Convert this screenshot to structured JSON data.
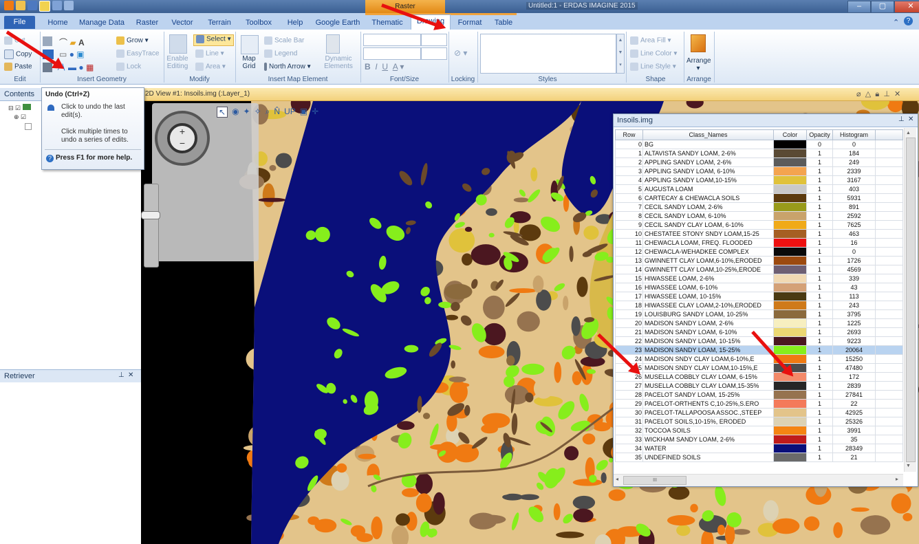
{
  "titlebar": {
    "context_label": "Raster",
    "window_title": "Untitled:1 - ERDAS IMAGINE 2015",
    "min": "–",
    "max": "▢",
    "close": "✕"
  },
  "tabs": [
    "File",
    "Home",
    "Manage Data",
    "Raster",
    "Vector",
    "Terrain",
    "Toolbox",
    "Help",
    "Google Earth",
    "Thematic",
    "Drawing",
    "Format",
    "Table"
  ],
  "ribbon": {
    "edit": {
      "cut": "Cut",
      "copy": "Copy",
      "paste": "Paste",
      "label": "Edit"
    },
    "insert_geometry": {
      "grow": "Grow",
      "easytrace": "EasyTrace",
      "lock": "Lock",
      "label": "Insert Geometry"
    },
    "modify": {
      "enable_editing": "Enable Editing",
      "select": "Select",
      "line": "Line",
      "area": "Area",
      "label": "Modify"
    },
    "insert_map_element": {
      "map_grid": "Map Grid",
      "scale_bar": "Scale Bar",
      "legend": "Legend",
      "north_arrow": "North Arrow",
      "dynamic_elements": "Dynamic Elements",
      "label": "Insert Map Element"
    },
    "font_size": {
      "bold": "B",
      "italic": "I",
      "underline": "U",
      "color": "A",
      "label": "Font/Size"
    },
    "locking": {
      "label": "Locking"
    },
    "styles": {
      "label": "Styles"
    },
    "shape": {
      "area_fill": "Area Fill",
      "line_color": "Line Color",
      "line_style": "Line Style",
      "label": "Shape"
    },
    "arrange": {
      "arrange": "Arrange",
      "label": "Arrange"
    }
  },
  "contents": {
    "title": "Contents"
  },
  "retriever": {
    "title": "Retriever"
  },
  "tooltip": {
    "title": "Undo (Ctrl+Z)",
    "line1": "Click to undo the last edit(s).",
    "line2": "Click multiple times to undo a series of edits.",
    "help": "Press F1 for more help."
  },
  "view": {
    "title": "2D View #1: Insoils.img (:Layer_1)"
  },
  "attribute_panel": {
    "title": "Insoils.img",
    "columns": [
      "Row",
      "Class_Names",
      "Color",
      "Opacity",
      "Histogram"
    ],
    "selected_row": 23,
    "rows": [
      {
        "row": "0",
        "name": "BG",
        "color": "#000000",
        "opacity": "0",
        "hist": "0"
      },
      {
        "row": "1",
        "name": "ALTAVISTA SANDY LOAM, 2-6%",
        "color": "#5a4a34",
        "opacity": "1",
        "hist": "184"
      },
      {
        "row": "2",
        "name": "APPLING SANDY LOAM, 2-6%",
        "color": "#5b5b5b",
        "opacity": "1",
        "hist": "249"
      },
      {
        "row": "3",
        "name": "APPLING SANDY LOAM, 6-10%",
        "color": "#f4a44f",
        "opacity": "1",
        "hist": "2339"
      },
      {
        "row": "4",
        "name": "APPLING SANDY LOAM,10-15%",
        "color": "#e0c23b",
        "opacity": "1",
        "hist": "3167"
      },
      {
        "row": "5",
        "name": "AUGUSTA LOAM",
        "color": "#c9c9c9",
        "opacity": "1",
        "hist": "403"
      },
      {
        "row": "6",
        "name": "CARTECAY & CHEWACLA SOILS",
        "color": "#5c3a0e",
        "opacity": "1",
        "hist": "5931"
      },
      {
        "row": "7",
        "name": "CECIL SANDY LOAM, 2-6%",
        "color": "#999b1a",
        "opacity": "1",
        "hist": "891"
      },
      {
        "row": "8",
        "name": "CECIL SANDY LOAM, 6-10%",
        "color": "#c9a36b",
        "opacity": "1",
        "hist": "2592"
      },
      {
        "row": "9",
        "name": "CECIL SANDY CLAY LOAM, 6-10%",
        "color": "#f0aa19",
        "opacity": "1",
        "hist": "7625"
      },
      {
        "row": "10",
        "name": "CHESTATEE STONY SNDY LOAM,15-25",
        "color": "#a65f23",
        "opacity": "1",
        "hist": "463"
      },
      {
        "row": "11",
        "name": "CHEWACLA LOAM, FREQ. FLOODED",
        "color": "#ee1111",
        "opacity": "1",
        "hist": "16"
      },
      {
        "row": "12",
        "name": "CHEWACLA-WEHADKEE COMPLEX",
        "color": "#0a0a0a",
        "opacity": "1",
        "hist": "0"
      },
      {
        "row": "13",
        "name": "GWINNETT CLAY LOAM,6-10%,ERODED",
        "color": "#9c4a0f",
        "opacity": "1",
        "hist": "1726"
      },
      {
        "row": "14",
        "name": "GWINNETT CLAY LOAM,10-25%,ERODE",
        "color": "#6e5f73",
        "opacity": "1",
        "hist": "4569"
      },
      {
        "row": "15",
        "name": "HIWASSEE LOAM, 2-6%",
        "color": "#f1d9b3",
        "opacity": "1",
        "hist": "339"
      },
      {
        "row": "16",
        "name": "HIWASSEE LOAM, 6-10%",
        "color": "#d4a177",
        "opacity": "1",
        "hist": "43"
      },
      {
        "row": "17",
        "name": "HIWASSEE LOAM, 10-15%",
        "color": "#4a3a12",
        "opacity": "1",
        "hist": "113"
      },
      {
        "row": "18",
        "name": "HIWASSEE CLAY LOAM,2-10%,ERODED",
        "color": "#cf7a1a",
        "opacity": "1",
        "hist": "243"
      },
      {
        "row": "19",
        "name": "LOUISBURG SANDY LOAM, 10-25%",
        "color": "#8b6a3d",
        "opacity": "1",
        "hist": "3795"
      },
      {
        "row": "20",
        "name": "MADISON SANDY LOAM, 2-6%",
        "color": "#f7efc0",
        "opacity": "1",
        "hist": "1225"
      },
      {
        "row": "21",
        "name": "MADISON SANDY LOAM, 6-10%",
        "color": "#ecd873",
        "opacity": "1",
        "hist": "2693"
      },
      {
        "row": "22",
        "name": "MADISON SANDY LOAM, 10-15%",
        "color": "#4b1720",
        "opacity": "1",
        "hist": "9223"
      },
      {
        "row": "23",
        "name": "MADISON SANDY LOAM, 15-25%",
        "color": "#86ee1c",
        "opacity": "1",
        "hist": "20064"
      },
      {
        "row": "24",
        "name": "MADISON SNDY CLAY LOAM,6-10%,E",
        "color": "#f07a12",
        "opacity": "1",
        "hist": "15250"
      },
      {
        "row": "25",
        "name": "MADISON SNDY CLAY LOAM,10-15%,E",
        "color": "#4c4c4c",
        "opacity": "1",
        "hist": "47480"
      },
      {
        "row": "26",
        "name": "MUSELLA COBBLY CLAY LOAM, 6-15%",
        "color": "#f38a6a",
        "opacity": "1",
        "hist": "172"
      },
      {
        "row": "27",
        "name": "MUSELLA COBBLY CLAY LOAM,15-35%",
        "color": "#262626",
        "opacity": "1",
        "hist": "2839"
      },
      {
        "row": "28",
        "name": "PACELOT SANDY LOAM, 15-25%",
        "color": "#96734f",
        "opacity": "1",
        "hist": "27841"
      },
      {
        "row": "29",
        "name": "PACELOT-ORTHENTS C,10-25%,S.ERO",
        "color": "#f47a5a",
        "opacity": "1",
        "hist": "22"
      },
      {
        "row": "30",
        "name": "PACELOT-TALLAPOOSA ASSOC.,STEEP",
        "color": "#e3c48a",
        "opacity": "1",
        "hist": "42925"
      },
      {
        "row": "31",
        "name": "PACELOT SOILS,10-15%, ERODED",
        "color": "#ddd2b3",
        "opacity": "1",
        "hist": "25326"
      },
      {
        "row": "32",
        "name": "TOCCOA SOILS",
        "color": "#f58412",
        "opacity": "1",
        "hist": "3991"
      },
      {
        "row": "33",
        "name": "WICKHAM SANDY LOAM, 2-6%",
        "color": "#c01b1b",
        "opacity": "1",
        "hist": "35"
      },
      {
        "row": "34",
        "name": "WATER",
        "color": "#0a0f7a",
        "opacity": "1",
        "hist": "28349"
      },
      {
        "row": "35",
        "name": "UNDEFINED SOILS",
        "color": "#6a6a6a",
        "opacity": "1",
        "hist": "21"
      }
    ]
  },
  "map": {
    "water": "#0a0f7a",
    "green": "#86ee1c",
    "orange": "#f07a12",
    "tan": "#e3c48a",
    "gray": "#4c4c4c",
    "brown": "#96734f"
  },
  "annotation_color": "#e8100f",
  "scroll_label": "III"
}
